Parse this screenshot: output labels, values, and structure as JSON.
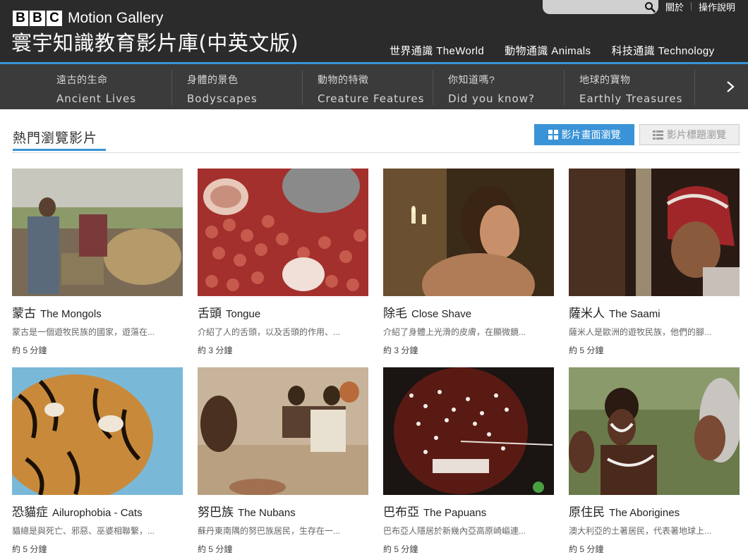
{
  "header": {
    "brand_letters": [
      "B",
      "B",
      "C"
    ],
    "brand_name": "Motion Gallery",
    "site_title": "寰宇知識教育影片庫(中英文版)",
    "util_links": [
      "關於",
      "操作說明"
    ],
    "top_nav": [
      "世界通識 TheWorld",
      "動物通識 Animals",
      "科技通識 Technology"
    ]
  },
  "categories": [
    {
      "zh": "遠古的生命",
      "en": "Ancient Lives"
    },
    {
      "zh": "身體的景色",
      "en": "Bodyscapes"
    },
    {
      "zh": "動物的特徵",
      "en": "Creature Features"
    },
    {
      "zh": "你知道嗎?",
      "en": "Did you know?"
    },
    {
      "zh": "地球的寶物",
      "en": "Earthly Treasures"
    }
  ],
  "section": {
    "title": "熱門瀏覽影片",
    "view_grid_label": "影片畫面瀏覽",
    "view_list_label": "影片標題瀏覽"
  },
  "videos": [
    {
      "zh": "蒙古",
      "en": "The Mongols",
      "desc": "蒙古是一個遊牧民族的國家，遊蕩在...",
      "duration": "約 5 分鐘"
    },
    {
      "zh": "舌頭",
      "en": "Tongue",
      "desc": "介紹了人的舌頭，以及舌頭的作用、...",
      "duration": "約 3 分鐘"
    },
    {
      "zh": "除毛",
      "en": "Close Shave",
      "desc": "介紹了身體上光滑的皮膚，在顯微鏡...",
      "duration": "約 3 分鐘"
    },
    {
      "zh": "薩米人",
      "en": "The Saami",
      "desc": "薩米人是歐洲的遊牧民族，他們的腳...",
      "duration": "約 5 分鐘"
    },
    {
      "zh": "恐貓症",
      "en": "Ailurophobia - Cats",
      "desc": "貓總是與死亡、邪惡、巫婆相聯繫，...",
      "duration": "約 5 分鐘"
    },
    {
      "zh": "努巴族",
      "en": "The Nubans",
      "desc": "蘇丹東南隅的努巴族居民，生存在一...",
      "duration": "約 5 分鐘"
    },
    {
      "zh": "巴布亞",
      "en": "The Papuans",
      "desc": "巴布亞人隱居於新幾內亞高原崎嶇連...",
      "duration": "約 5 分鐘"
    },
    {
      "zh": "原住民",
      "en": "The Aborigines",
      "desc": "澳大利亞的土著居民，代表著地球上...",
      "duration": "約 5 分鐘"
    }
  ],
  "colors": {
    "accent": "#3a93d6",
    "header_bg": "#2b2b2b",
    "category_bg": "#3b3b3b"
  }
}
